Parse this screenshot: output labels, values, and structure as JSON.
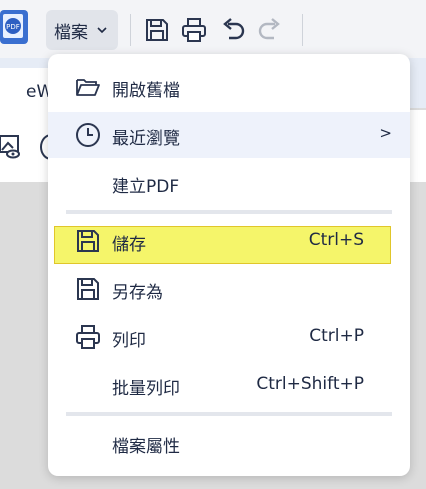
{
  "toolbar": {
    "file_menu_label": "檔案",
    "icons": [
      "app-logo-icon",
      "chevron-down-icon",
      "save-icon",
      "print-icon",
      "undo-icon",
      "redo-icon"
    ]
  },
  "tab": {
    "label": "eW"
  },
  "menu": {
    "items": [
      {
        "label": "開啟舊檔",
        "icon": "folder-open-icon",
        "shortcut": ""
      },
      {
        "label": "最近瀏覽",
        "icon": "clock-icon",
        "shortcut": "",
        "submenu_arrow": ">"
      },
      {
        "label": "建立PDF",
        "icon": "",
        "shortcut": ""
      },
      {
        "label": "儲存",
        "icon": "save-icon",
        "shortcut": "Ctrl+S"
      },
      {
        "label": "另存為",
        "icon": "save-as-icon",
        "shortcut": ""
      },
      {
        "label": "列印",
        "icon": "print-icon",
        "shortcut": "Ctrl+P"
      },
      {
        "label": "批量列印",
        "icon": "",
        "shortcut": "Ctrl+Shift+P"
      },
      {
        "label": "檔案屬性",
        "icon": "",
        "shortcut": ""
      }
    ]
  },
  "colors": {
    "highlight": "#f5f56a",
    "highlight_border": "#e0c62a",
    "hover_row": "#eef2fb",
    "text": "#1f2a44"
  }
}
